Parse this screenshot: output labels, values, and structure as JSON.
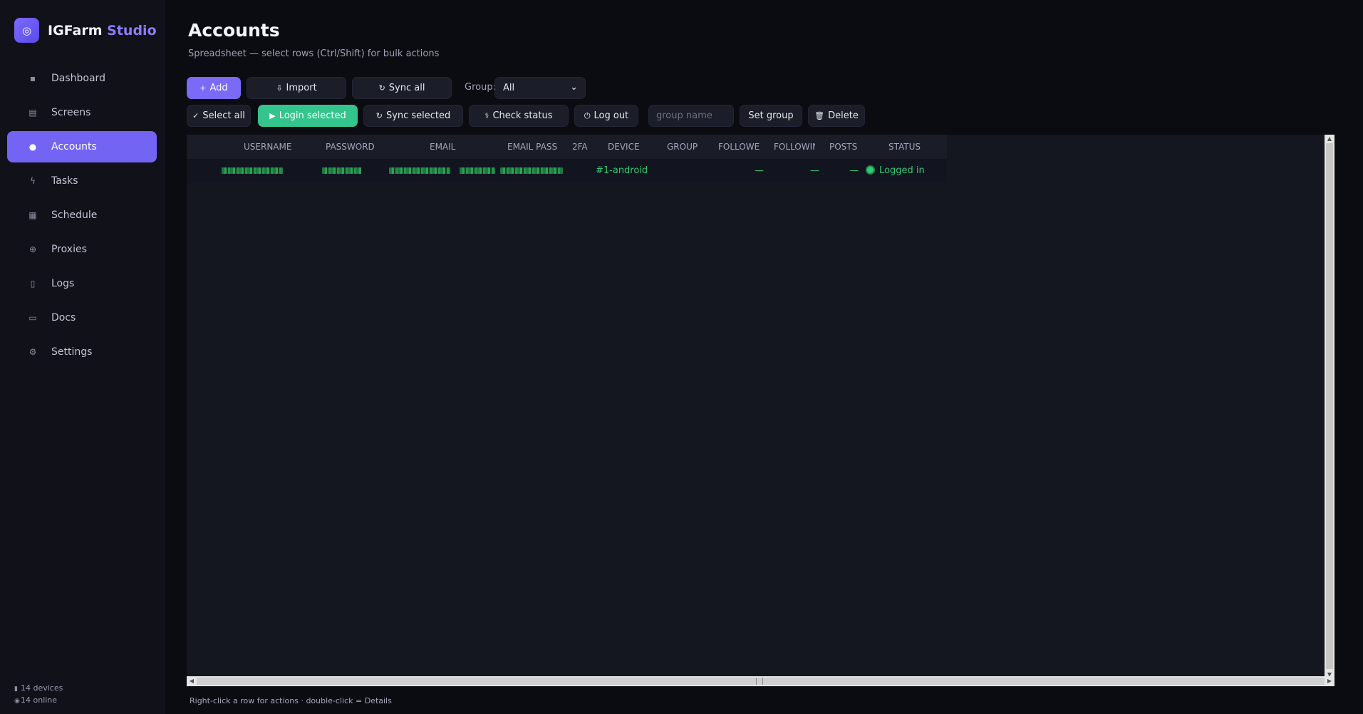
{
  "brand": {
    "name": "IGFarm",
    "accent": "Studio",
    "logo_icon": "logo-icon"
  },
  "nav": [
    {
      "label": "Dashboard",
      "icon": "dashboard-icon"
    },
    {
      "label": "Screens",
      "icon": "screens-icon"
    },
    {
      "label": "Accounts",
      "icon": "user-icon",
      "active": true
    },
    {
      "label": "Tasks",
      "icon": "bolt-icon"
    },
    {
      "label": "Schedule",
      "icon": "calendar-icon"
    },
    {
      "label": "Proxies",
      "icon": "globe-icon"
    },
    {
      "label": "Logs",
      "icon": "document-icon"
    },
    {
      "label": "Docs",
      "icon": "book-icon"
    },
    {
      "label": "Settings",
      "icon": "gear-icon"
    }
  ],
  "sidebar_footer": {
    "devices": "14 devices",
    "online": "14 online"
  },
  "page": {
    "title": "Accounts",
    "subtitle": "Spreadsheet — select rows (Ctrl/Shift) for bulk actions"
  },
  "toolbar1": {
    "add": "Add",
    "import": "Import",
    "sync_all": "Sync all",
    "group_label": "Group:",
    "group_value": "All"
  },
  "toolbar2": {
    "select_all": "Select all",
    "login_selected": "Login selected",
    "sync_selected": "Sync selected",
    "check_status": "Check status",
    "log_out": "Log out",
    "group_name_placeholder": "group name",
    "set_group": "Set group",
    "delete": "Delete"
  },
  "table": {
    "columns": [
      "USERNAME",
      "PASSWORD",
      "EMAIL",
      "EMAIL PASS",
      "2FA",
      "DEVICE",
      "GROUP",
      "FOLLOWEF",
      "FOLLOWIN",
      "POSTS",
      "STATUS"
    ],
    "rows": [
      {
        "device": "#1-android",
        "followers": "—",
        "following": "—",
        "posts": "—",
        "status": "Logged in"
      }
    ]
  },
  "footer_hint": "Right-click a row for actions · double-click = Details",
  "colors": {
    "accent": "#7464f4",
    "green": "#2ecc71",
    "login_button": "#34c48d"
  }
}
